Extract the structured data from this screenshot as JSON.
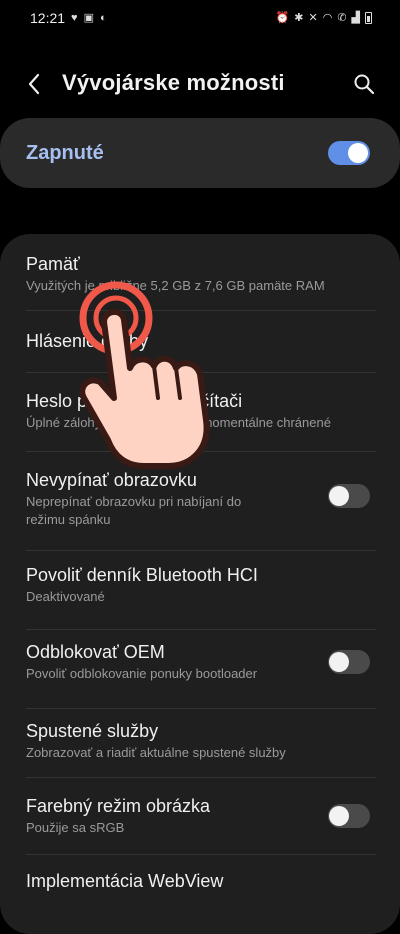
{
  "status_bar": {
    "time": "12:21"
  },
  "header": {
    "title": "Vývojárske možnosti"
  },
  "master": {
    "label": "Zapnuté",
    "enabled": true
  },
  "items": [
    {
      "title": "Pamäť",
      "subtitle": "Využitých je približne 5,2 GB z 7,6 GB pamäte RAM"
    },
    {
      "title": "Hlásenie chyby",
      "subtitle": ""
    },
    {
      "title": "Heslo pre zálohu v počítači",
      "subtitle": "Úplné zálohy v počítači nie sú momentálne chránené"
    },
    {
      "title": "Nevypínať obrazovku",
      "subtitle": "Neprepínať obrazovku pri nabíjaní do režimu spánku",
      "toggle": false
    },
    {
      "title": "Povoliť denník Bluetooth HCI",
      "subtitle": "Deaktivované"
    },
    {
      "title": "Odblokovať OEM",
      "subtitle": "Povoliť odblokovanie ponuky bootloader",
      "toggle": false
    },
    {
      "title": "Spustené služby",
      "subtitle": "Zobrazovať a riadiť aktuálne spustené služby"
    },
    {
      "title": "Farebný režim obrázka",
      "subtitle": "Použije sa sRGB",
      "toggle": false
    },
    {
      "title": "Implementácia WebView",
      "subtitle": ""
    }
  ],
  "colors": {
    "accent": "#5f8fe6",
    "master_label": "#a6bff0",
    "hand_outline": "#3a1a14",
    "hand_fill": "#ffd3c4",
    "tap_ring": "#f0584a"
  }
}
